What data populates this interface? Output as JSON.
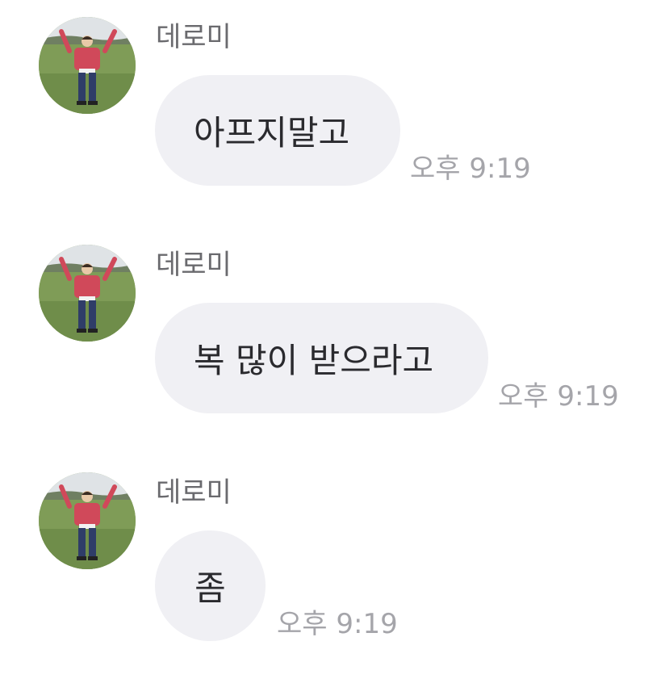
{
  "messages": [
    {
      "sender": "데로미",
      "text": "아프지말고",
      "time": "오후 9:19"
    },
    {
      "sender": "데로미",
      "text": "복 많이 받으라고",
      "time": "오후 9:19"
    },
    {
      "sender": "데로미",
      "text": "좀",
      "time": "오후 9:19"
    }
  ],
  "colors": {
    "bubble": "#f0f0f4",
    "sender_text": "#6a6a6e",
    "message_text": "#2a2a2e",
    "time_text": "#a5a5aa"
  },
  "icons": {
    "avatar": "profile-photo-person-in-field"
  }
}
